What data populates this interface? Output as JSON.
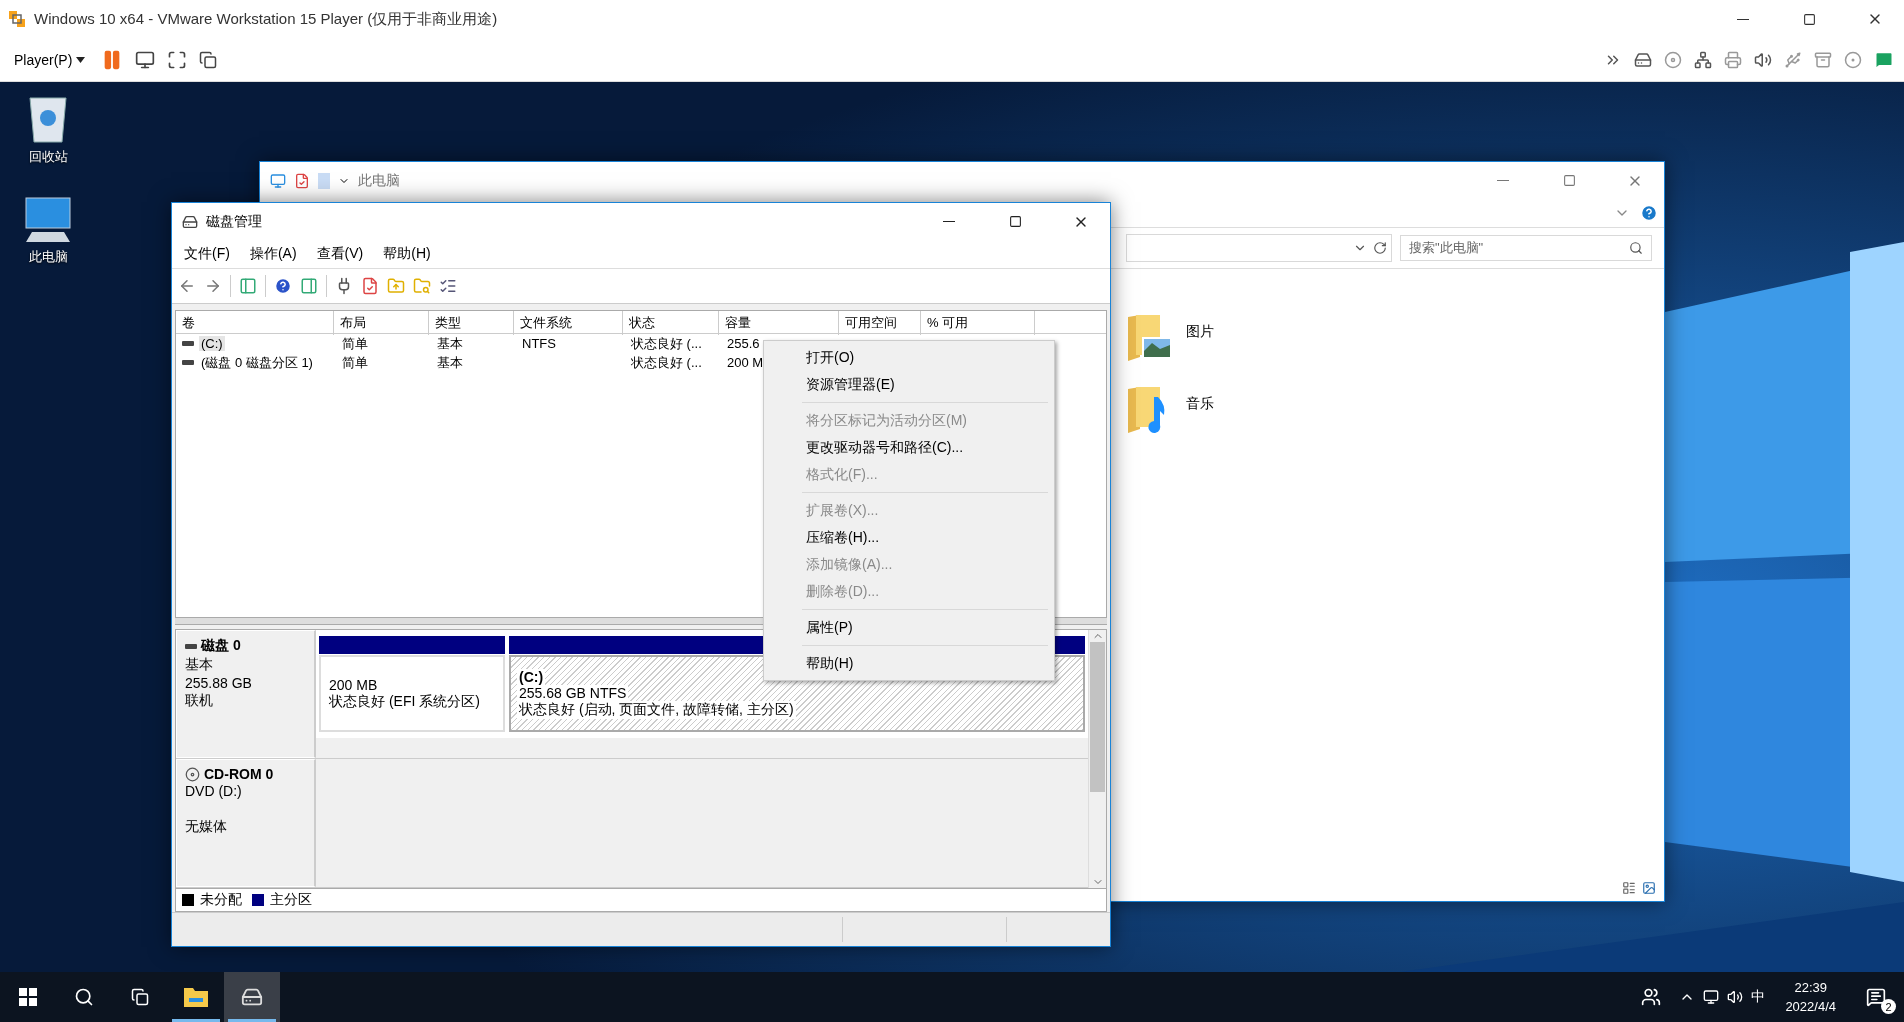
{
  "vmware": {
    "title": "Windows 10 x64 - VMware Workstation 15 Player (仅用于非商业用途)",
    "player_menu": "Player(P)"
  },
  "desktop_icons": [
    {
      "label": "回收站",
      "kind": "recycle"
    },
    {
      "label": "此电脑",
      "kind": "computer"
    }
  ],
  "explorer": {
    "title": "此电脑",
    "search_placeholder": "搜索\"此电脑\"",
    "items": [
      {
        "label": "图片",
        "kind": "pictures"
      },
      {
        "label": "音乐",
        "kind": "music"
      }
    ]
  },
  "disk_management": {
    "title": "磁盘管理",
    "menus": [
      "文件(F)",
      "操作(A)",
      "查看(V)",
      "帮助(H)"
    ],
    "columns": [
      "卷",
      "布局",
      "类型",
      "文件系统",
      "状态",
      "容量",
      "可用空间",
      "% 可用"
    ],
    "rows": [
      {
        "selected": true,
        "cells": [
          "(C:)",
          "简单",
          "基本",
          "NTFS",
          "状态良好 (...",
          "255.6"
        ]
      },
      {
        "selected": false,
        "cells": [
          "(磁盘 0 磁盘分区 1)",
          "简单",
          "基本",
          "",
          "状态良好 (...",
          "200 M"
        ]
      }
    ],
    "disks": [
      {
        "kind": "disk",
        "name": "磁盘 0",
        "lines": [
          "基本",
          "255.88 GB",
          "联机"
        ],
        "partitions": [
          {
            "kind": "plain",
            "lines": [
              "200 MB",
              "状态良好 (EFI 系统分区)"
            ]
          },
          {
            "kind": "hatched",
            "title": "(C:)",
            "lines": [
              "255.68 GB NTFS",
              "状态良好 (启动, 页面文件, 故障转储, 主分区)"
            ]
          }
        ]
      },
      {
        "kind": "cdrom",
        "name": "CD-ROM 0",
        "lines": [
          "DVD (D:)"
        ],
        "note": "无媒体"
      }
    ],
    "legend": [
      {
        "label": "未分配",
        "color": "#000000"
      },
      {
        "label": "主分区",
        "color": "#000080"
      }
    ],
    "context_menu": [
      [
        {
          "label": "打开(O)",
          "disabled": false
        },
        {
          "label": "资源管理器(E)",
          "disabled": false
        }
      ],
      [
        {
          "label": "将分区标记为活动分区(M)",
          "disabled": true
        },
        {
          "label": "更改驱动器号和路径(C)...",
          "disabled": false
        },
        {
          "label": "格式化(F)...",
          "disabled": true
        }
      ],
      [
        {
          "label": "扩展卷(X)...",
          "disabled": true
        },
        {
          "label": "压缩卷(H)...",
          "disabled": false
        },
        {
          "label": "添加镜像(A)...",
          "disabled": true
        },
        {
          "label": "删除卷(D)...",
          "disabled": true
        }
      ],
      [
        {
          "label": "属性(P)",
          "disabled": false
        }
      ],
      [
        {
          "label": "帮助(H)",
          "disabled": false
        }
      ]
    ]
  },
  "taskbar": {
    "apps": [
      {
        "kind": "explorer",
        "selected": false
      },
      {
        "kind": "diskmgmt",
        "selected": true
      }
    ],
    "ime": "中",
    "time": "22:39",
    "date": "2022/4/4",
    "notifications": "2"
  }
}
